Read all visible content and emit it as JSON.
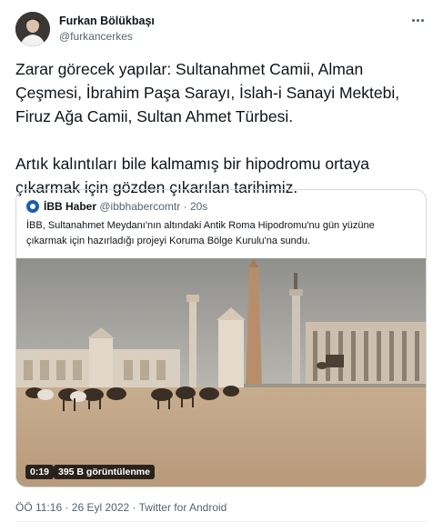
{
  "author": {
    "display_name": "Furkan Bölükbaşı",
    "handle": "@furkancerkes",
    "avatar_icon": "profile-photo"
  },
  "more_icon": "more-horizontal-icon",
  "tweet": {
    "text": "Zarar görecek yapılar: Sultanahmet Camii, Alman Çeşmesi, İbrahim Paşa Sarayı, İslah-i Sanayi Mektebi, Firuz Ağa Camii, Sultan Ahmet Türbesi.\n\nArtık kalıntıları bile kalmamış bir hipodromu ortaya çıkarmak için gözden çıkarılan tarihimiz."
  },
  "quoted_tweet": {
    "name": "İBB Haber",
    "handle": "@ibbhabercomtr",
    "separator": "·",
    "time": "20s",
    "text": "İBB, Sultanahmet Meydanı'nın altındaki Antik Roma Hipodromu'nu gün yüzüne çıkarmak için hazırladığı projeyi Koruma Bölge Kurulu'na sundu.",
    "video": {
      "duration": "0:19",
      "views": "395 B görüntülenme"
    }
  },
  "footer": {
    "text": "ÖÖ 11:16 · 26 Eyl 2022 · Twitter for Android"
  },
  "colors": {
    "text": "#0f1419",
    "secondary": "#536471",
    "border": "#cfd9de"
  }
}
